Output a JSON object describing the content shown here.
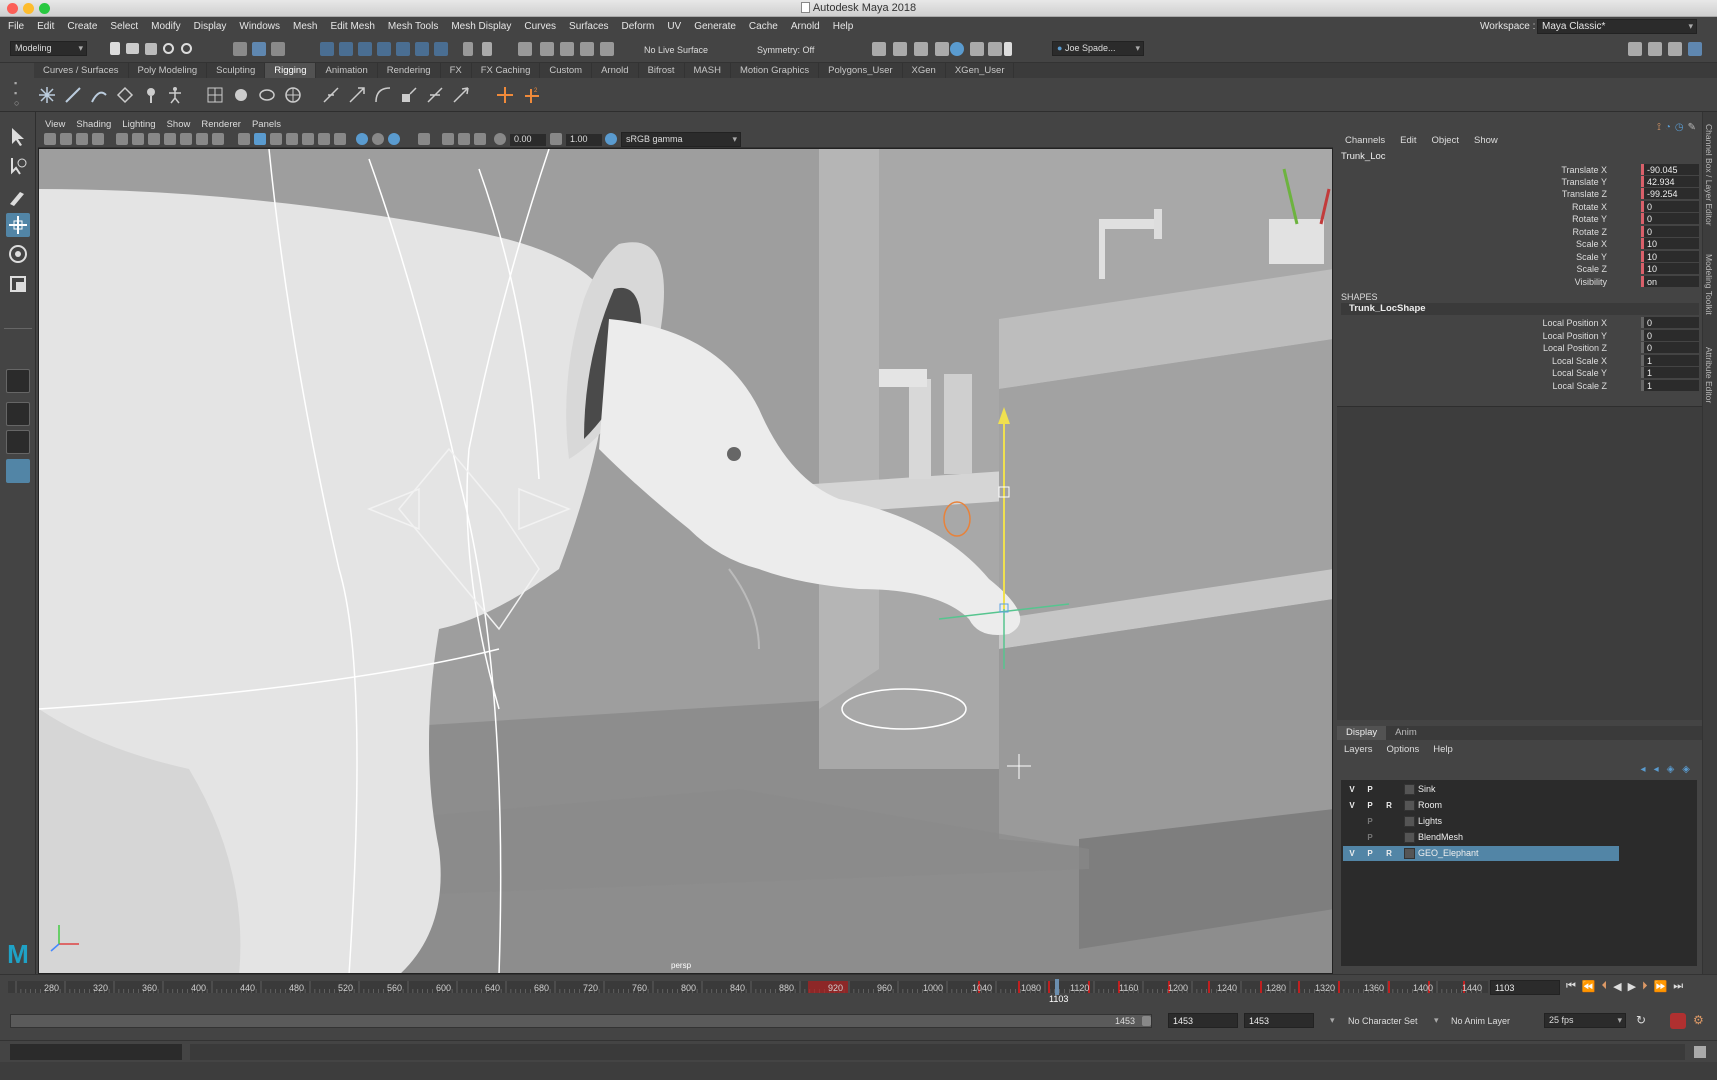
{
  "window": {
    "title": "Autodesk Maya 2018"
  },
  "menu": [
    "File",
    "Edit",
    "Create",
    "Select",
    "Modify",
    "Display",
    "Windows",
    "Mesh",
    "Edit Mesh",
    "Mesh Tools",
    "Mesh Display",
    "Curves",
    "Surfaces",
    "Deform",
    "UV",
    "Generate",
    "Cache",
    "Arnold",
    "Help"
  ],
  "workspace": {
    "label": "Workspace :",
    "value": "Maya Classic*"
  },
  "status": {
    "mode": "Modeling",
    "live_surface": "No Live Surface",
    "symmetry": "Symmetry: Off",
    "user": "Joe Spade..."
  },
  "shelf_tabs": [
    {
      "label": "Curves / Surfaces"
    },
    {
      "label": "Poly Modeling"
    },
    {
      "label": "Sculpting"
    },
    {
      "label": "Rigging",
      "active": true
    },
    {
      "label": "Animation"
    },
    {
      "label": "Rendering"
    },
    {
      "label": "FX"
    },
    {
      "label": "FX Caching"
    },
    {
      "label": "Custom"
    },
    {
      "label": "Arnold"
    },
    {
      "label": "Bifrost"
    },
    {
      "label": "MASH"
    },
    {
      "label": "Motion Graphics"
    },
    {
      "label": "Polygons_User"
    },
    {
      "label": "XGen"
    },
    {
      "label": "XGen_User"
    }
  ],
  "panel": {
    "menu": [
      "View",
      "Shading",
      "Lighting",
      "Show",
      "Renderer",
      "Panels"
    ],
    "exposure": "0.00",
    "gamma": "1.00",
    "color_space": "sRGB gamma",
    "camera_label": "persp"
  },
  "channel_box": {
    "menu": [
      "Channels",
      "Edit",
      "Object",
      "Show"
    ],
    "object": "Trunk_Loc",
    "channels": [
      {
        "label": "Translate X",
        "value": "-90.045",
        "keyed": true
      },
      {
        "label": "Translate Y",
        "value": "42.934",
        "keyed": true
      },
      {
        "label": "Translate Z",
        "value": "-99.254",
        "keyed": true
      },
      {
        "label": "Rotate X",
        "value": "0",
        "keyed": true
      },
      {
        "label": "Rotate Y",
        "value": "0",
        "keyed": true
      },
      {
        "label": "Rotate Z",
        "value": "0",
        "keyed": true
      },
      {
        "label": "Scale X",
        "value": "10",
        "keyed": true
      },
      {
        "label": "Scale Y",
        "value": "10",
        "keyed": true
      },
      {
        "label": "Scale Z",
        "value": "10",
        "keyed": true
      },
      {
        "label": "Visibility",
        "value": "on",
        "keyed": true
      }
    ],
    "shapes_header": "SHAPES",
    "shape": "Trunk_LocShape",
    "shape_channels": [
      {
        "label": "Local Position X",
        "value": "0"
      },
      {
        "label": "Local Position Y",
        "value": "0"
      },
      {
        "label": "Local Position Z",
        "value": "0"
      },
      {
        "label": "Local Scale X",
        "value": "1"
      },
      {
        "label": "Local Scale Y",
        "value": "1"
      },
      {
        "label": "Local Scale Z",
        "value": "1"
      }
    ]
  },
  "layer_editor": {
    "tabs": [
      {
        "label": "Display",
        "active": true
      },
      {
        "label": "Anim"
      }
    ],
    "menu": [
      "Layers",
      "Options",
      "Help"
    ],
    "layers": [
      {
        "v": "V",
        "p": "P",
        "r": "",
        "name": "Sink"
      },
      {
        "v": "V",
        "p": "P",
        "r": "R",
        "name": "Room"
      },
      {
        "v": "",
        "p": "P",
        "r": "",
        "name": "Lights"
      },
      {
        "v": "",
        "p": "P",
        "r": "",
        "name": "BlendMesh"
      },
      {
        "v": "V",
        "p": "P",
        "r": "R",
        "name": "GEO_Elephant",
        "selected": true
      }
    ]
  },
  "side_tabs": [
    "Channel Box / Layer Editor",
    "Modeling Toolkit",
    "Attribute Editor"
  ],
  "timeline": {
    "ticks": [
      "280",
      "320",
      "360",
      "400",
      "440",
      "480",
      "520",
      "560",
      "600",
      "640",
      "680",
      "720",
      "760",
      "800",
      "840",
      "880",
      "920",
      "960",
      "1000",
      "1040",
      "1080",
      "1120",
      "1160",
      "1200",
      "1240",
      "1280",
      "1320",
      "1360",
      "1400",
      "1440"
    ],
    "current": "1103",
    "current_field": "1103"
  },
  "range": {
    "end_inner": "1453",
    "end_a": "1453",
    "end_b": "1453",
    "character_set": "No Character Set",
    "anim_layer": "No Anim Layer",
    "fps": "25 fps"
  }
}
